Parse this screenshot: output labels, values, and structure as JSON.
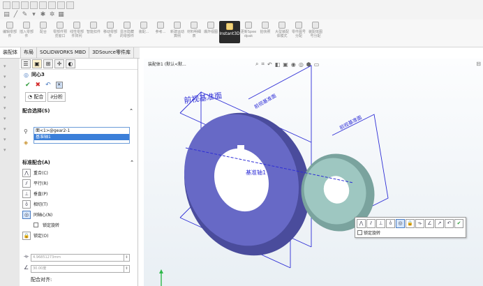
{
  "ribbon": {
    "items": [
      {
        "icon": "edit-part-icon",
        "label": "编辑零部件"
      },
      {
        "icon": "insert-component-icon",
        "label": "插入零部件"
      },
      {
        "icon": "mate-icon",
        "label": "配合"
      },
      {
        "icon": "component-preview-icon",
        "label": "零部件预览窗口"
      },
      {
        "icon": "linear-pattern-icon",
        "label": "线性零部件阵列"
      },
      {
        "icon": "smart-fastener-icon",
        "label": "智能扣件"
      },
      {
        "icon": "move-component-icon",
        "label": "移动零部件"
      },
      {
        "icon": "show-hidden-icon",
        "label": "显示隐藏的零部件"
      },
      {
        "icon": "assembly-feature-icon",
        "label": "装配..."
      },
      {
        "icon": "reference-geometry-icon",
        "label": "参考..."
      },
      {
        "icon": "new-motion-study-icon",
        "label": "新建运动算例"
      },
      {
        "icon": "bom-icon",
        "label": "材料明细表"
      },
      {
        "icon": "exploded-view-icon",
        "label": "爆炸视图"
      },
      {
        "icon": "instant3d-icon",
        "label": "Instant3D"
      },
      {
        "icon": "update-speedpak-icon",
        "label": "更新Speedpak"
      },
      {
        "icon": "snapshot-icon",
        "label": "拍快照"
      },
      {
        "icon": "large-assembly-icon",
        "label": "大型装配体模式"
      },
      {
        "icon": "part-map-icon",
        "label": "零件图号分配"
      },
      {
        "icon": "assembly-map-icon",
        "label": "装配体图号分配"
      }
    ]
  },
  "tabs": [
    "装配体",
    "布局",
    "SOLIDWORKS MBD",
    "3DSource零件库"
  ],
  "panel": {
    "title": "同心3",
    "sub_tabs": [
      "配合",
      "分析"
    ],
    "selection_header": "配合选择(S)",
    "selections": [
      "面<1>@gear2-1",
      "基准轴1"
    ],
    "standard_header": "标准配合(A)",
    "mate_types": [
      {
        "icon": "coincident-icon",
        "label": "重合(C)"
      },
      {
        "icon": "parallel-icon",
        "label": "平行(R)"
      },
      {
        "icon": "perpendicular-icon",
        "label": "垂直(P)"
      },
      {
        "icon": "tangent-icon",
        "label": "相切(T)"
      },
      {
        "icon": "concentric-icon",
        "label": "同轴心(N)"
      }
    ],
    "lock_rotation": "锁定旋转",
    "lock_label": "锁定(O)",
    "distance_value": "4.96851273mm",
    "angle_value": "30.00度",
    "alignment_label": "配合对齐:"
  },
  "viewport": {
    "tree_label": "装配体1 (默认<默...",
    "plane_front": "前视基准面",
    "plane_label_2": "前视基准面",
    "plane_label_3": "前视基准面",
    "axis_label": "基准轴1",
    "context_lock": "锁定旋转"
  }
}
